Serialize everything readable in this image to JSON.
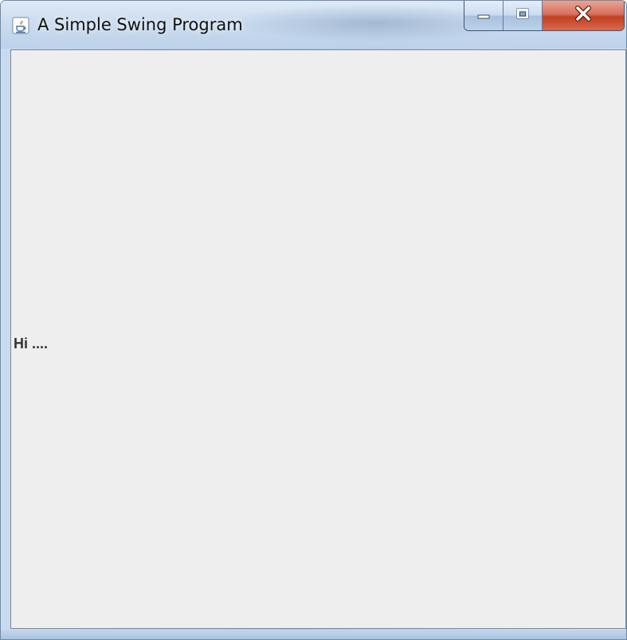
{
  "window": {
    "title": "A Simple Swing Program",
    "app_icon": "java-icon"
  },
  "caption_buttons": {
    "minimize_icon": "minimize-icon",
    "maximize_icon": "maximize-icon",
    "close_icon": "close-icon"
  },
  "content": {
    "label_text": "Hi ...."
  },
  "colors": {
    "client_background": "#eeeeee",
    "label_text": "#333333",
    "close_button_red": "#c23f22",
    "frame_blue": "#b7cde6"
  }
}
